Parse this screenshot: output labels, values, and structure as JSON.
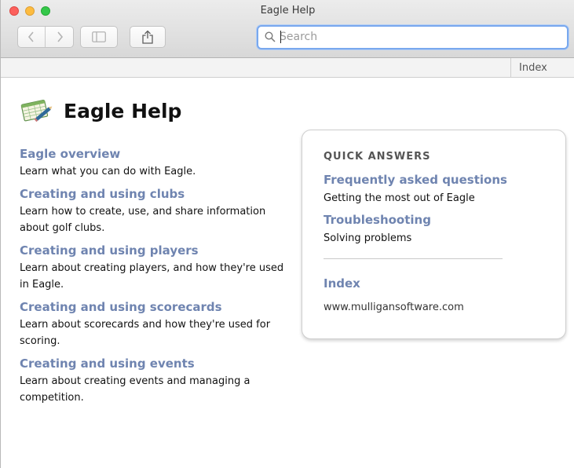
{
  "window": {
    "title": "Eagle Help"
  },
  "toolbar": {
    "back_icon": "chevron-left-icon",
    "forward_icon": "chevron-right-icon",
    "sidebar_icon": "sidebar-icon",
    "share_icon": "share-icon"
  },
  "search": {
    "placeholder": "Search",
    "value": ""
  },
  "index_bar": {
    "label": "Index"
  },
  "page": {
    "title": "Eagle Help",
    "icon": "scorecard-pencil-icon"
  },
  "topics": [
    {
      "title": "Eagle overview",
      "desc": "Learn what you can do with Eagle."
    },
    {
      "title": "Creating and using clubs",
      "desc": "Learn how to create, use, and share information about golf clubs."
    },
    {
      "title": "Creating and using players",
      "desc": "Learn about creating players, and how they're used in Eagle."
    },
    {
      "title": "Creating and using scorecards",
      "desc": "Learn about scorecards and how they're used for scoring."
    },
    {
      "title": "Creating and using events",
      "desc": "Learn about creating events and managing a competition."
    }
  ],
  "quick_answers": {
    "heading": "QUICK ANSWERS",
    "faq_title": "Frequently asked questions",
    "faq_desc": "Getting the most out of Eagle",
    "troubleshooting_title": "Troubleshooting",
    "troubleshooting_desc": "Solving problems",
    "index_title": "Index",
    "website": "www.mulligansoftware.com"
  },
  "colors": {
    "link": "#6f84b0",
    "search_focus": "#79a8ee"
  }
}
